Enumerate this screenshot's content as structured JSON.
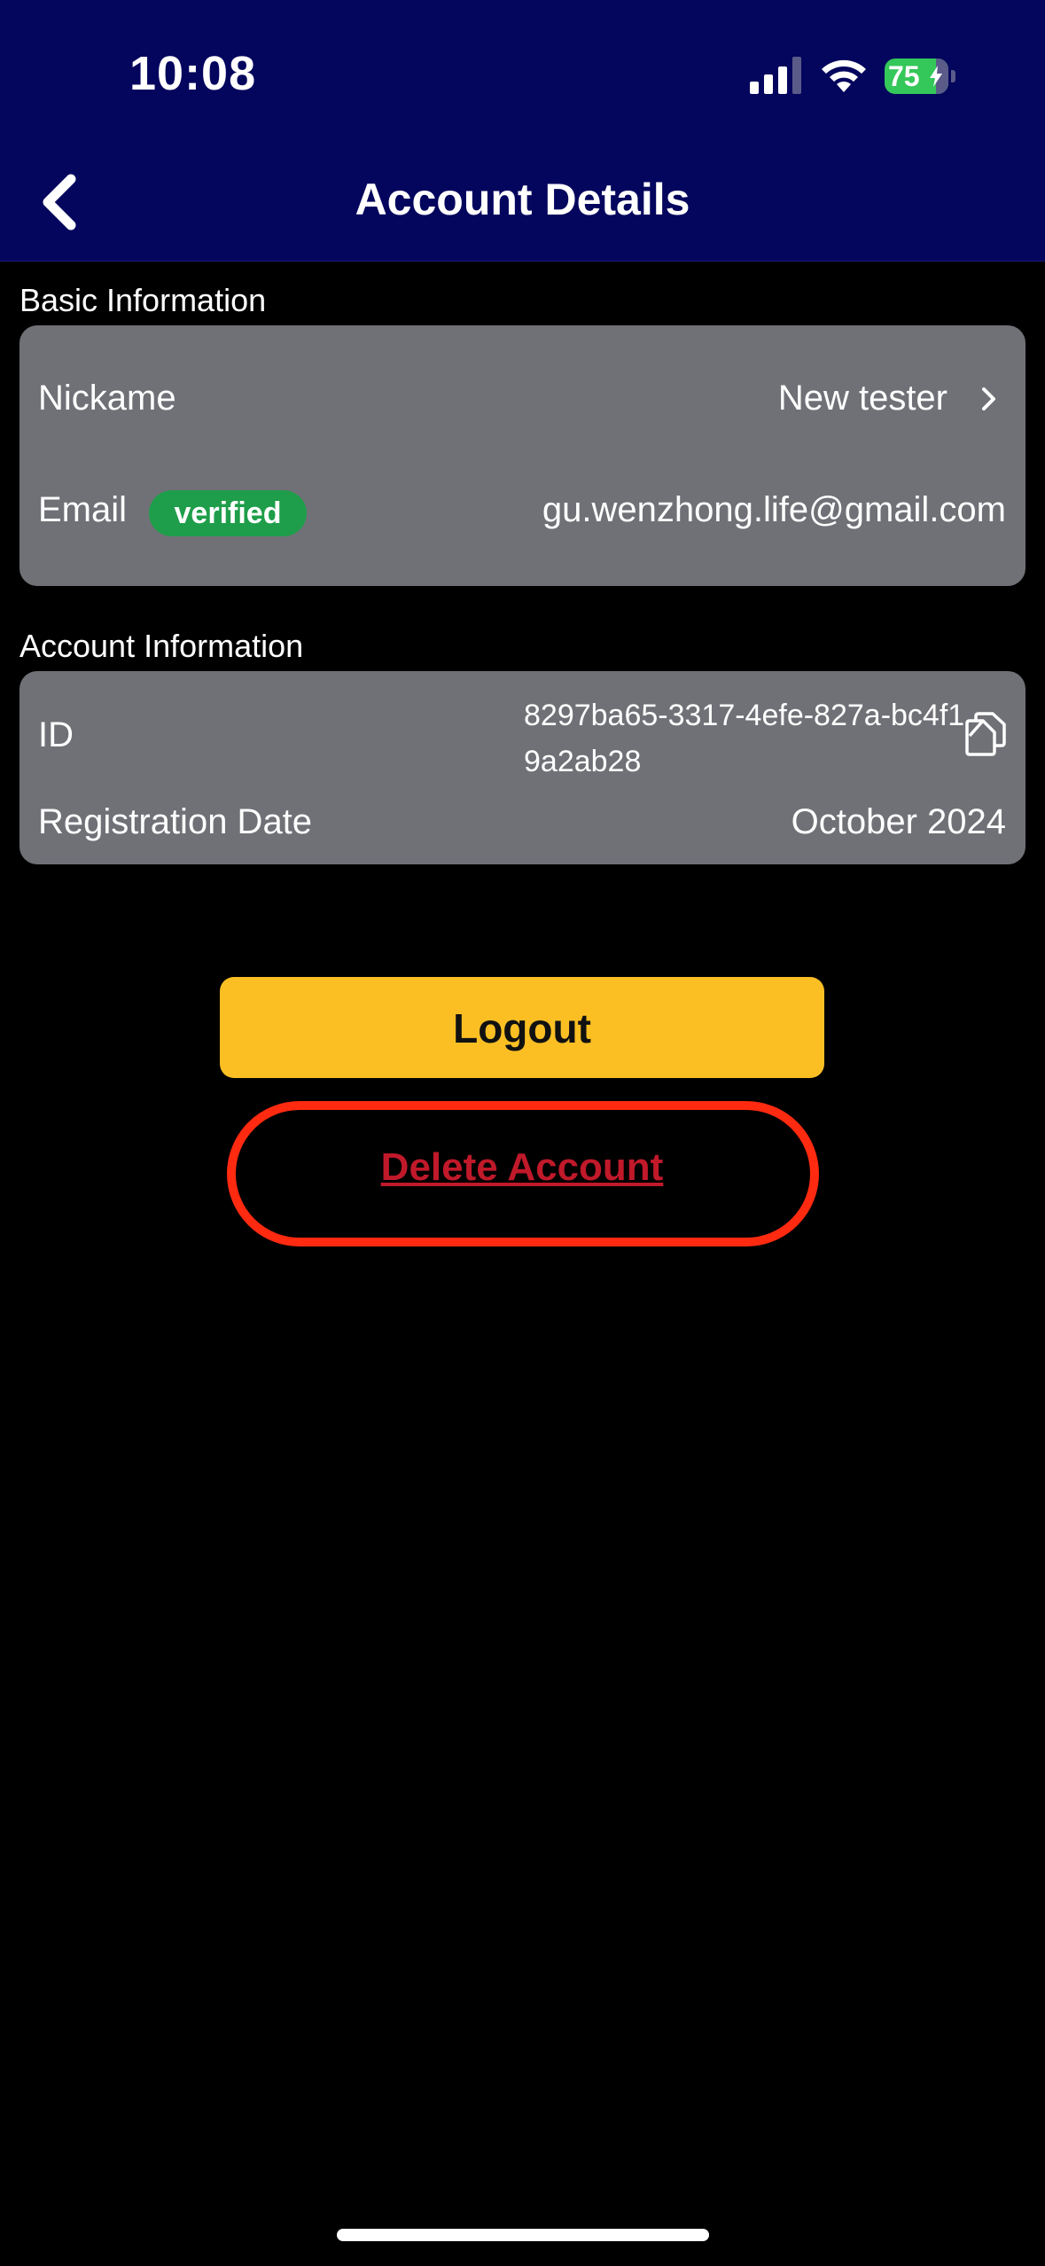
{
  "status_bar": {
    "time": "10:08",
    "battery_percent": "75",
    "icons": [
      "signal-icon",
      "wifi-icon",
      "battery-icon"
    ]
  },
  "header": {
    "title": "Account Details",
    "back_icon": "chevron-left-icon"
  },
  "basic_information": {
    "section_title": "Basic Information",
    "nickname_label": "Nickame",
    "nickname_value": "New tester",
    "email_label": "Email",
    "email_badge": "verified",
    "email_value": "gu.wenzhong.life@gmail.com"
  },
  "account_information": {
    "section_title": "Account Information",
    "id_label": "ID",
    "id_value": "8297ba65-3317-4efe-827a-bc4f19a2ab28",
    "registration_label": "Registration Date",
    "registration_value": "October 2024"
  },
  "actions": {
    "logout_label": "Logout",
    "delete_label": "Delete Account"
  },
  "colors": {
    "header_bg": "#04055d",
    "card_bg": "#707177",
    "verified_badge": "#1e9e4a",
    "logout_button": "#fbbf24",
    "delete_text": "#c0192a",
    "highlight_ring": "#ff2a10"
  }
}
